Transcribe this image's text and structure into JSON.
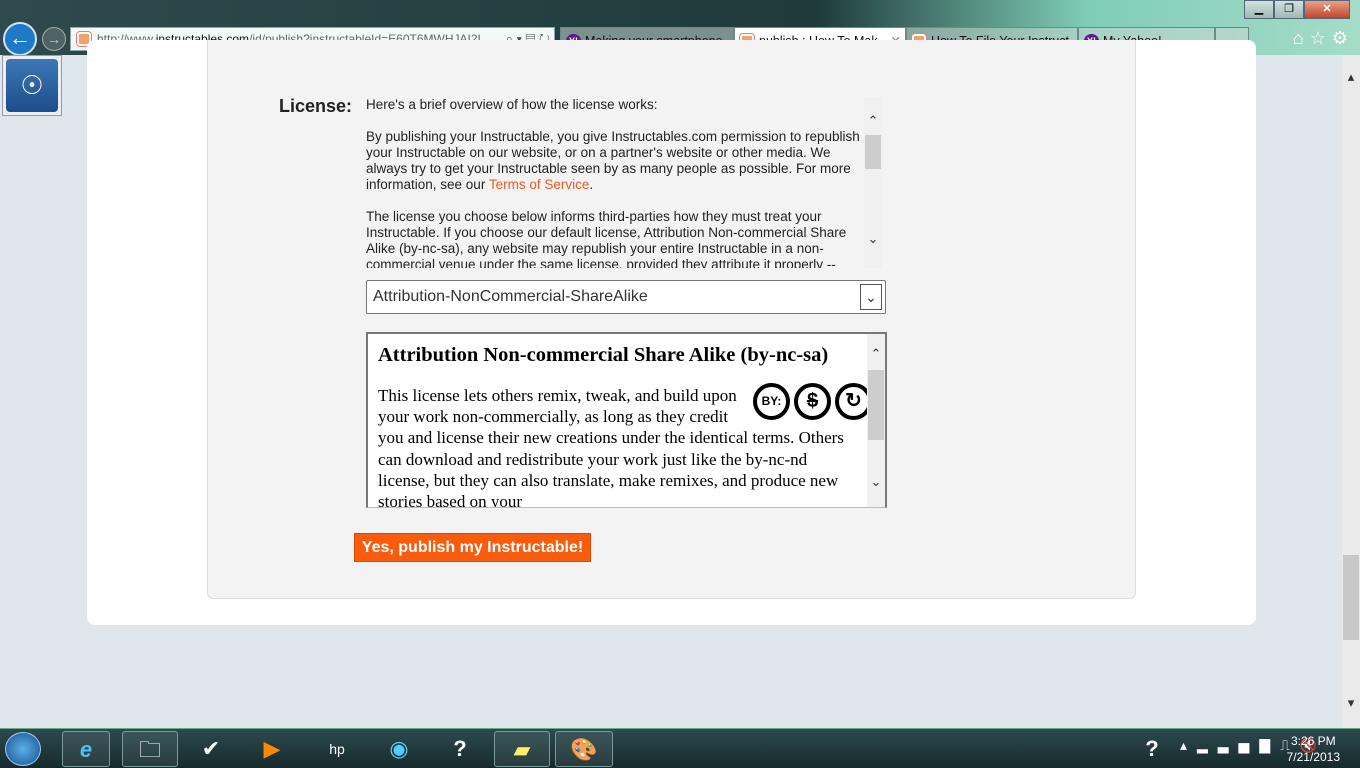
{
  "browser": {
    "url_prefix": "http://www.",
    "url_domain": "instructables.com",
    "url_path": "/id/publish?instructableId=E60T6MWHJAI2I",
    "tabs": [
      {
        "label": "Making your smartphone...",
        "icon": "yahoo-icon",
        "active": false
      },
      {
        "label": "publish : How To Mak...",
        "icon": "instructables-icon",
        "active": true
      },
      {
        "label": "How To File Your Instruct...",
        "icon": "instructables-icon",
        "active": false
      },
      {
        "label": "My Yahoo!",
        "icon": "yahoo-icon",
        "active": false
      }
    ]
  },
  "license": {
    "label": "License:",
    "overview_intro": "Here's a brief overview of how the license works:",
    "para1": "By publishing your Instructable, you give Instructables.com permission to republish your Instructable on our website, or on a partner's website or other media. We always try to get your Instructable seen by as many people as possible. For more information, see our ",
    "tos_link": "Terms of Service",
    "para1_end": ".",
    "para2": "The license you choose below informs third-parties how they must treat your Instructable. If you choose our default license, Attribution Non-commercial Share Alike (by-nc-sa), any website may republish your entire Instructable in a non-commercial venue under the same license, provided they attribute it properly --",
    "selected": "Attribution-NonCommercial-ShareAlike",
    "detail_title": "Attribution Non-commercial Share Alike (by-nc-sa)",
    "detail_text": "This license lets others remix, tweak, and build upon your work non-commercially, as long as they credit you and license their new creations under the identical terms. Others can download and redistribute your work just like the by-nc-nd license, but they can also translate, make remixes, and produce new stories based on your",
    "cc_icons": [
      "BY:",
      "$",
      "↻"
    ]
  },
  "publish_button": "Yes, publish my Instructable!",
  "tray": {
    "time": "3:26 PM",
    "date": "7/21/2013"
  },
  "accent": "#fa5c0e",
  "link_color": "#f15a22"
}
